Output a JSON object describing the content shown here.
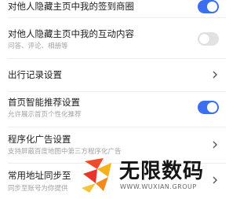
{
  "settings": [
    {
      "title": "对他人隐藏主页中我的签到商圈",
      "subtitle": "",
      "control": "toggle",
      "on": true
    },
    {
      "title": "对他人隐藏主页中我的互动内容",
      "subtitle": "问答、评论、相册等",
      "control": "toggle",
      "on": false
    },
    {
      "title": "出行记录设置",
      "subtitle": "",
      "control": "chevron"
    },
    {
      "title": "首页智能推荐设置",
      "subtitle": "允许展示首页个性化推荐",
      "control": "toggle",
      "on": true
    },
    {
      "title": "程序化广告设置",
      "subtitle": "支持屏蔽百度地图中第三方程序化广告",
      "control": "chevron"
    },
    {
      "title": "常用地址同步至",
      "subtitle": "同步至账号为你提供",
      "control": "chevron"
    }
  ],
  "watermark": {
    "name": "无限数码",
    "url": "WWW.WUXIAN.GROUP"
  },
  "colors": {
    "accent": "#3a6ff0",
    "toggle_off": "#e2e2e2",
    "text": "#1e1e1e",
    "subtext": "#a3a3a3"
  }
}
